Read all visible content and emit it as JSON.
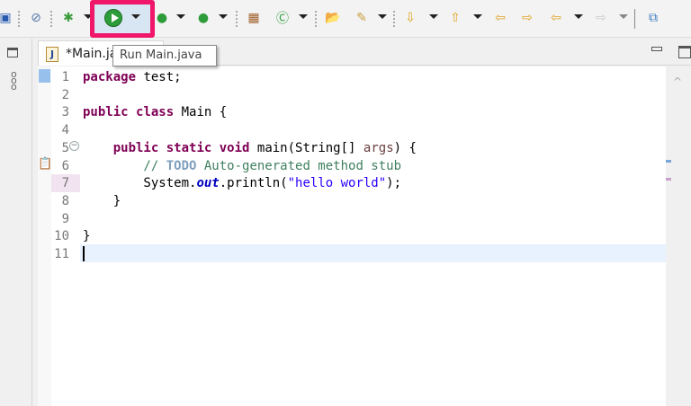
{
  "toolbar": {
    "items": [
      "new-console-icon",
      "skip-breakpoints-icon",
      "debug-icon",
      "run-icon",
      "coverage-icon",
      "external-tools-icon",
      "new-java-package-icon",
      "new-java-class-icon",
      "open-type-icon",
      "search-icon",
      "next-annotation-icon",
      "previous-annotation-icon",
      "last-edit-location-icon",
      "forward-edit-icon",
      "back-icon",
      "forward-icon",
      "open-perspective-icon"
    ],
    "highlight_color": "#f0166a"
  },
  "tooltip": {
    "text": "Run Main.java"
  },
  "editor": {
    "tab_label": "*Main.java",
    "lines": [
      [
        {
          "t": "kw",
          "v": "package"
        },
        {
          "t": "tx",
          "v": " test;"
        }
      ],
      [],
      [
        {
          "t": "kw",
          "v": "public"
        },
        {
          "t": "tx",
          "v": " "
        },
        {
          "t": "kw",
          "v": "class"
        },
        {
          "t": "tx",
          "v": " Main {"
        }
      ],
      [],
      [
        {
          "t": "tx",
          "v": "    "
        },
        {
          "t": "kw",
          "v": "public"
        },
        {
          "t": "tx",
          "v": " "
        },
        {
          "t": "kw",
          "v": "static"
        },
        {
          "t": "tx",
          "v": " "
        },
        {
          "t": "kw",
          "v": "void"
        },
        {
          "t": "tx",
          "v": " main(String[] "
        },
        {
          "t": "ar",
          "v": "args"
        },
        {
          "t": "tx",
          "v": ") {"
        }
      ],
      [
        {
          "t": "cm",
          "v": "        // "
        },
        {
          "t": "todo",
          "v": "TODO"
        },
        {
          "t": "cm",
          "v": " Auto-generated method stub"
        }
      ],
      [
        {
          "t": "tx",
          "v": "        System."
        },
        {
          "t": "fi",
          "v": "out"
        },
        {
          "t": "tx",
          "v": ".println("
        },
        {
          "t": "st",
          "v": "\"hello world\""
        },
        {
          "t": "tx",
          "v": ");"
        }
      ],
      [
        {
          "t": "tx",
          "v": "    }"
        }
      ],
      [],
      [
        {
          "t": "tx",
          "v": "}"
        }
      ],
      []
    ]
  }
}
